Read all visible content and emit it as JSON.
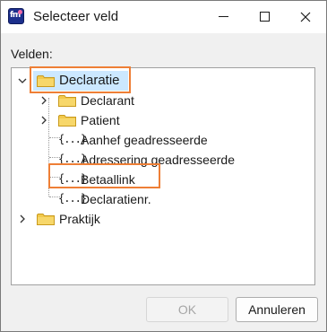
{
  "window": {
    "title": "Selecteer veld",
    "app_icon": "fm-app-icon"
  },
  "titlebar_buttons": {
    "minimize": "minimize-icon",
    "maximize": "maximize-icon",
    "close": "close-icon"
  },
  "fields_label": "Velden:",
  "tree": {
    "declaratie": {
      "label": "Declaratie",
      "expanded": true,
      "selected": true,
      "children": {
        "declarant": {
          "label": "Declarant",
          "expanded": false
        },
        "patient": {
          "label": "Patient",
          "expanded": false
        },
        "aanhef": {
          "label": "Aanhef geadresseerde"
        },
        "adressering": {
          "label": "Adressering geadresseerde"
        },
        "betaallink": {
          "label": "Betaallink",
          "highlighted": true
        },
        "declaratienr": {
          "label": "Declaratienr."
        }
      }
    },
    "praktijk": {
      "label": "Praktijk",
      "expanded": false
    }
  },
  "field_icon_glyph": "{...}",
  "buttons": {
    "ok": "OK",
    "cancel": "Annuleren"
  },
  "colors": {
    "highlight_border": "#ee7f36",
    "selection_bg": "#cce8ff",
    "folder": "#f2c94c"
  }
}
